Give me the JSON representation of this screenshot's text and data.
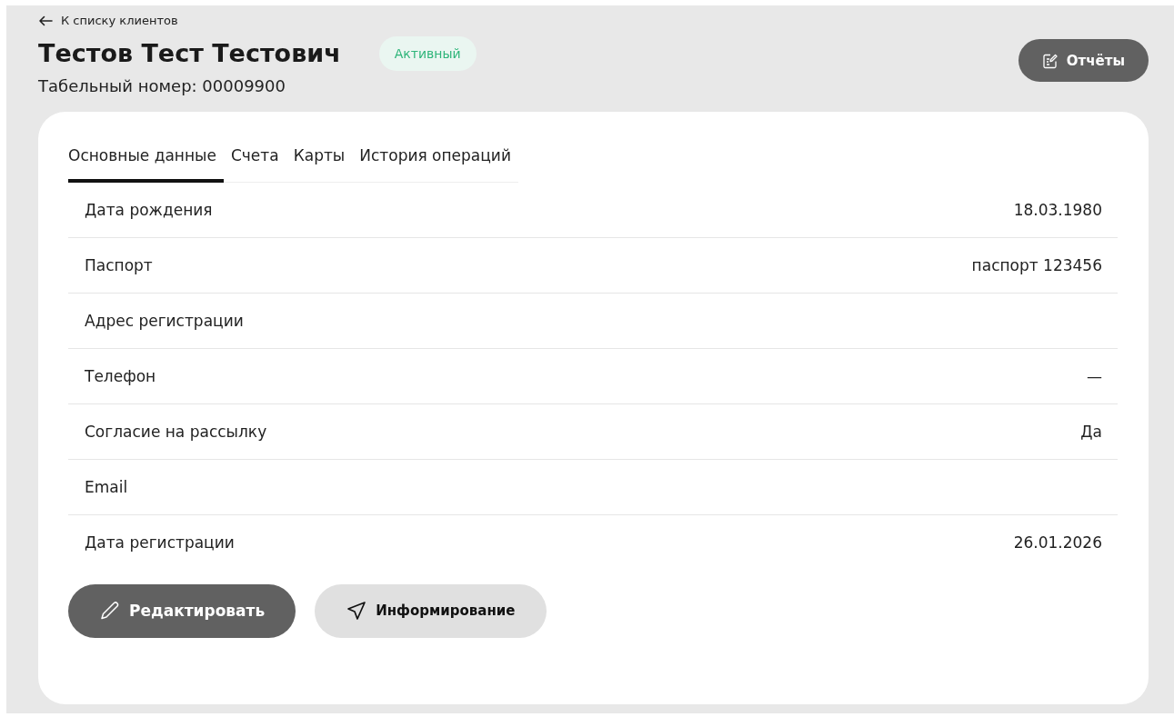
{
  "back_link": {
    "label": "К списку клиентов"
  },
  "header": {
    "name": "Тестов Тест Тестович",
    "status": "Активный",
    "employee_number": "Табельный номер: 00009900"
  },
  "reports_button": {
    "label": "Отчёты"
  },
  "tabs": [
    {
      "label": "Основные данные",
      "selected": true
    },
    {
      "label": "Счета",
      "selected": false
    },
    {
      "label": "Карты",
      "selected": false
    },
    {
      "label": "История операций",
      "selected": false
    }
  ],
  "fields": [
    {
      "label": "Дата рождения",
      "value": "18.03.1980"
    },
    {
      "label": "Паспорт",
      "value": "паспорт 123456"
    },
    {
      "label": "Адрес регистрации"
    },
    {
      "label": "Телефон",
      "value": "—"
    },
    {
      "label": "Согласие на рассылку",
      "value": "Да"
    },
    {
      "label": "Email"
    },
    {
      "label": "Дата регистрации",
      "value": "26.01.2026"
    }
  ],
  "actions": [
    {
      "label": "Редактировать",
      "kind": "edit"
    },
    {
      "label": "Информирование",
      "kind": "notify"
    }
  ]
}
